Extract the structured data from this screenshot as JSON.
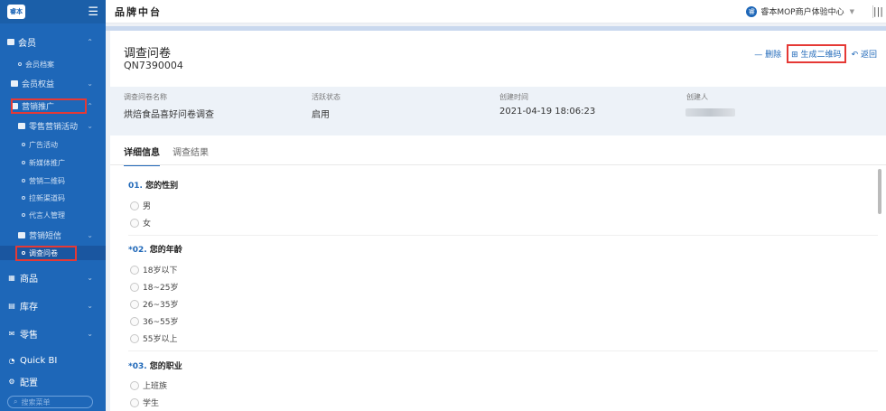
{
  "app": {
    "brand": "品牌中台",
    "user_name": "睿本MOP商户体验中心",
    "user_initial": "睿",
    "logo_text": "睿本"
  },
  "sidebar": {
    "member": "会员",
    "member_archive": "会员档案",
    "member_rights": "会员权益",
    "marketing": "营销推广",
    "retail_marketing": "零售营销活动",
    "ad": "广告活动",
    "new_media": "新媒体推广",
    "qr": "营销二维码",
    "pull_new": "拉新渠道码",
    "agent": "代言人管理",
    "marketing_sms": "营销短信",
    "survey": "调查问卷",
    "goods": "商品",
    "stock": "库存",
    "retail": "零售",
    "quickbi": "Quick BI",
    "config": "配置",
    "search_placeholder": "搜索菜单"
  },
  "header": {
    "title": "调查问卷",
    "code": "QN7390004"
  },
  "actions": {
    "delete": "删除",
    "qrcode": "生成二维码",
    "back": "返回"
  },
  "info": {
    "name_label": "调查问卷名称",
    "name_value": "烘焙食品喜好问卷调查",
    "status_label": "活跃状态",
    "status_value": "启用",
    "created_label": "创建时间",
    "created_value": "2021-04-19 18:06:23",
    "creator_label": "创建人"
  },
  "tabs": {
    "detail": "详细信息",
    "result": "调查结果"
  },
  "questions": {
    "q1_num": "01.",
    "q1_text": "您的性别",
    "q1_opt1": "男",
    "q1_opt2": "女",
    "q2_num": "*02.",
    "q2_text": "您的年龄",
    "q2_opt1": "18岁以下",
    "q2_opt2": "18~25岁",
    "q2_opt3": "26~35岁",
    "q2_opt4": "36~55岁",
    "q2_opt5": "55岁以上",
    "q3_num": "*03.",
    "q3_text": "您的职业",
    "q3_opt1": "上班族",
    "q3_opt2": "学生"
  },
  "colors": {
    "sidebar": "#1e67b8",
    "accent": "#1e67b8",
    "highlight": "#e53935"
  }
}
